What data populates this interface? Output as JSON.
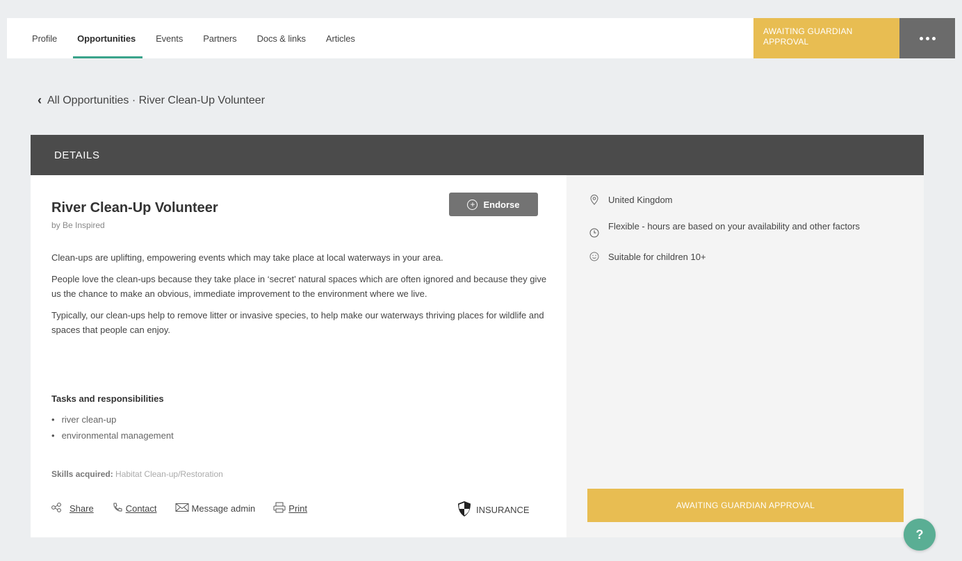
{
  "nav": {
    "tabs": [
      {
        "label": "Profile",
        "active": false
      },
      {
        "label": "Opportunities",
        "active": true
      },
      {
        "label": "Events",
        "active": false
      },
      {
        "label": "Partners",
        "active": false
      },
      {
        "label": "Docs & links",
        "active": false
      },
      {
        "label": "Articles",
        "active": false
      }
    ],
    "status_line1": "AWAITING GUARDIAN",
    "status_line2": "APPROVAL",
    "more_icon": "more-horizontal-icon"
  },
  "breadcrumb": {
    "back_icon": "chevron-left-icon",
    "text": "All Opportunities · River Clean-Up Volunteer"
  },
  "details": {
    "header": "DETAILS",
    "title": "River Clean-Up Volunteer",
    "byline": "by Be Inspired",
    "endorse_label": "Endorse",
    "paragraphs": [
      "Clean-ups are uplifting, empowering events which may take place at local waterways in your area.",
      "People love the clean-ups because they take place in ‘secret’ natural spaces which are often ignored and because they give us the chance to make an obvious, immediate improvement to the environment where we live.",
      "Typically, our clean-ups help to remove litter or invasive species, to help make our waterways thriving places for wildlife and spaces that people can enjoy."
    ],
    "tasks_title": "Tasks and responsibilities",
    "tasks": [
      "river clean-up",
      "environmental management"
    ],
    "skills_label": "Skills acquired:",
    "skills_value": "Habitat Clean-up/Restoration",
    "actions": {
      "share": "Share",
      "contact": "Contact",
      "message": "Message admin",
      "print": "Print"
    },
    "insurance_label": "INSURANCE"
  },
  "info": {
    "location": "United Kingdom",
    "time": "Flexible - hours are based on your availability and other factors",
    "age": "Suitable for children 10+",
    "await_button": "AWAITING GUARDIAN APPROVAL"
  },
  "help_label": "?",
  "colors": {
    "accent": "#3aa38a",
    "awaiting": "#e8bd52",
    "header_dark": "#4b4b4b"
  }
}
